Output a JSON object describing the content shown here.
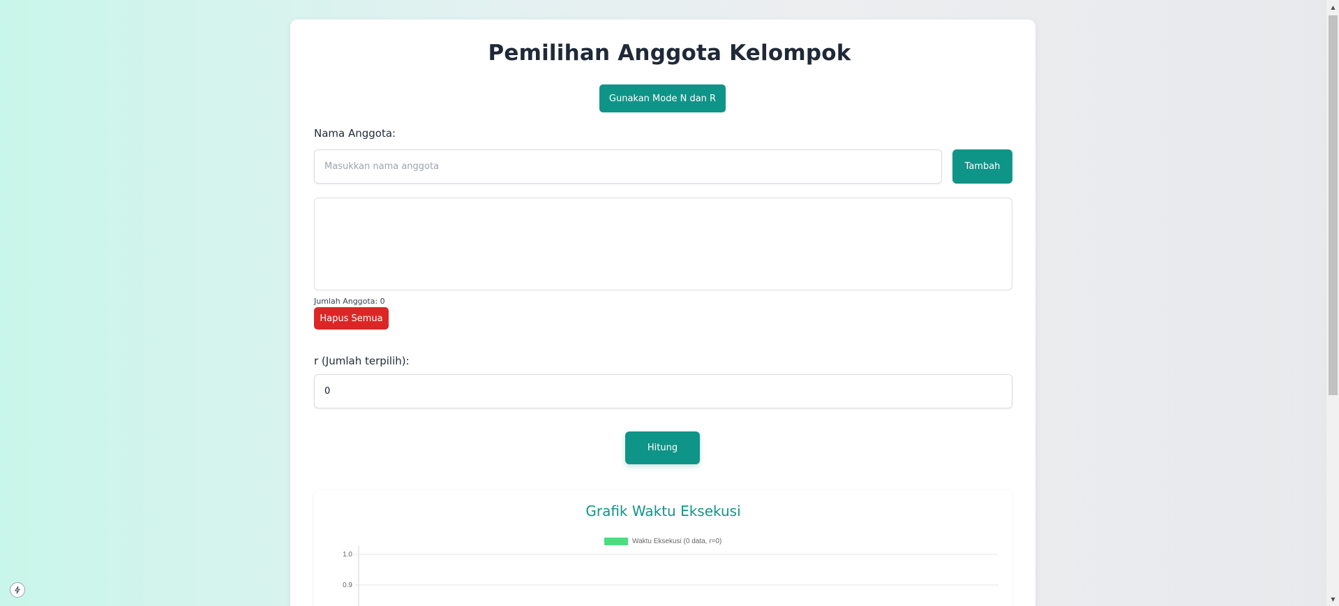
{
  "page": {
    "title": "Pemilihan Anggota Kelompok",
    "mode_button_label": "Gunakan Mode N dan R"
  },
  "member_form": {
    "label": "Nama Anggota:",
    "input_placeholder": "Masukkan nama anggota",
    "input_value": "",
    "add_button_label": "Tambah",
    "members": [],
    "count_text": "Jumlah Anggota: 0",
    "clear_button_label": "Hapus Semua"
  },
  "r_form": {
    "label": "r (Jumlah terpilih):",
    "value": "0"
  },
  "calculate_button_label": "Hitung",
  "chart_section": {
    "title": "Grafik Waktu Eksekusi"
  },
  "chart_data": {
    "type": "bar",
    "title": "Grafik Waktu Eksekusi",
    "series": [
      {
        "name": "Waktu Eksekusi (0 data, r=0)",
        "values": [],
        "color": "#4ade80"
      }
    ],
    "categories": [],
    "y_ticks_visible": [
      "1.0",
      "0.9"
    ],
    "ylim": [
      0,
      1.0
    ],
    "legend_position": "top-center",
    "grid": true
  },
  "icons": {
    "dev_tools": "bolt-icon",
    "scroll_up": "triangle-up",
    "scroll_down": "triangle-down"
  }
}
